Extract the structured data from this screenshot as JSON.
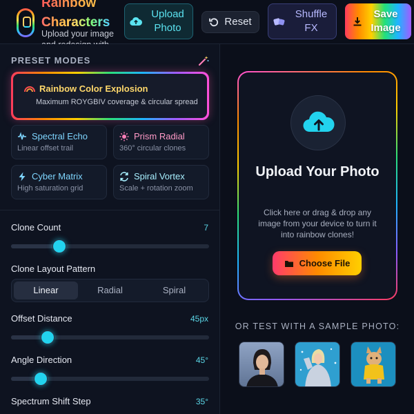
{
  "app": {
    "title_line1": "Rainbow",
    "title_line2": "Characters",
    "subtitle": "Upload your image and redesign with colorful rainbow characters"
  },
  "toolbar": {
    "upload_label": "Upload Photo",
    "reset_label": "Reset",
    "shuffle_label": "Shuffle FX",
    "save_label": "Save Image"
  },
  "presets": {
    "section_title": "PRESET MODES",
    "featured": {
      "title": "Rainbow Color Explosion",
      "subtitle": "Maximum ROYGBIV coverage & circular spread"
    },
    "modes": [
      {
        "title": "Spectral Echo",
        "subtitle": "Linear offset trail",
        "icon": "waveform-icon",
        "color": "#7fd6ff"
      },
      {
        "title": "Prism Radial",
        "subtitle": "360° circular clones",
        "icon": "sun-icon",
        "color": "#ff7fb8"
      },
      {
        "title": "Cyber Matrix",
        "subtitle": "High saturation grid",
        "icon": "lightning-icon",
        "color": "#7fd6ff"
      },
      {
        "title": "Spiral Vortex",
        "subtitle": "Scale + rotation zoom",
        "icon": "refresh-icon",
        "color": "#a8f0ff"
      }
    ]
  },
  "controls": {
    "clone_count": {
      "label": "Clone Count",
      "value": "7",
      "fraction": 0.244
    },
    "layout_pattern": {
      "label": "Clone Layout Pattern",
      "options": [
        "Linear",
        "Radial",
        "Spiral"
      ],
      "selected": "Linear"
    },
    "offset_distance": {
      "label": "Offset Distance",
      "value": "45px",
      "fraction": 0.185
    },
    "angle_direction": {
      "label": "Angle Direction",
      "value": "45°",
      "fraction": 0.15
    },
    "spectrum_shift": {
      "label": "Spectrum Shift Step",
      "value": "35°"
    }
  },
  "upload": {
    "title": "Upload Your Photo",
    "description": "Click here or drag & drop any image from your device to turn it into rainbow clones!",
    "button_label": "Choose File"
  },
  "samples": {
    "title": "OR TEST WITH A SAMPLE PHOTO:",
    "items": [
      "portrait",
      "winter-jacket-person",
      "dog-in-raincoat"
    ]
  },
  "colors": {
    "accent": "#22d3ee",
    "background": "#0b0f1a",
    "panel": "#0e1320"
  }
}
